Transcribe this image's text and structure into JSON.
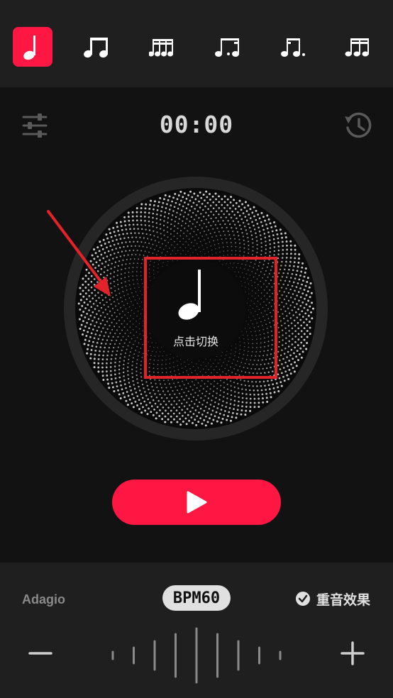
{
  "note_bar": {
    "items": [
      {
        "name": "quarter-note",
        "active": true
      },
      {
        "name": "eighth-notes",
        "active": false
      },
      {
        "name": "sixteenth-notes",
        "active": false
      },
      {
        "name": "triplet-notes",
        "active": false
      },
      {
        "name": "dotted-eighth-sixteenth",
        "active": false
      },
      {
        "name": "triplet-eighth-notes",
        "active": false
      }
    ]
  },
  "header": {
    "timer": "00:00",
    "left_icon": "sliders-icon",
    "right_icon": "history-icon"
  },
  "dial": {
    "center_label": "点击切换",
    "center_icon": "quarter-note-icon"
  },
  "controls": {
    "play_icon": "play-icon"
  },
  "bottom": {
    "tempo_name": "Adagio",
    "bpm_label": "BPM60",
    "accent_label": "重音效果",
    "accent_checked": true
  },
  "colors": {
    "accent": "#ff1744",
    "background": "#121212",
    "panel": "#1f1f1f",
    "annotation": "#e3232a"
  }
}
